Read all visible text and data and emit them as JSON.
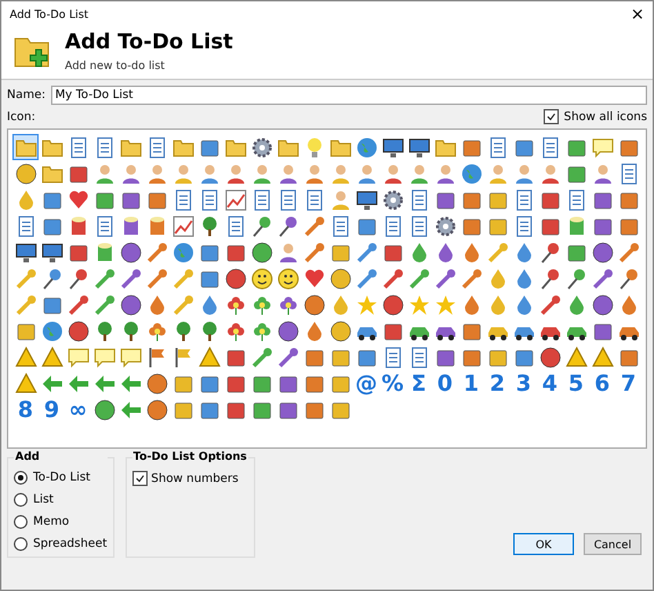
{
  "window": {
    "title": "Add To-Do List",
    "close": "×"
  },
  "header": {
    "title": "Add To-Do List",
    "subtitle": "Add new to-do list"
  },
  "name_field": {
    "label": "Name:",
    "value": "My To-Do List"
  },
  "icon_label": "Icon:",
  "show_all_icons": {
    "label": "Show all icons",
    "checked": true
  },
  "icon_rows": [
    [
      {
        "kind": "folder",
        "selected": true
      },
      {
        "kind": "folder",
        "selected": false
      },
      {
        "kind": "document",
        "selected": false
      },
      {
        "kind": "document",
        "selected": false
      },
      {
        "kind": "folder",
        "selected": false
      },
      {
        "kind": "document",
        "selected": false
      },
      {
        "kind": "folder",
        "selected": false
      },
      {
        "kind": "box",
        "selected": false
      },
      {
        "kind": "folder",
        "selected": false
      },
      {
        "kind": "gear",
        "selected": false
      },
      {
        "kind": "folder",
        "selected": false
      },
      {
        "kind": "bulb",
        "selected": false
      },
      {
        "kind": "folder",
        "selected": false
      },
      {
        "kind": "globe",
        "selected": false
      },
      {
        "kind": "monitor",
        "selected": false
      },
      {
        "kind": "monitor",
        "selected": false
      },
      {
        "kind": "folder",
        "selected": false
      },
      {
        "kind": "box",
        "selected": false
      },
      {
        "kind": "document",
        "selected": false
      },
      {
        "kind": "box",
        "selected": false
      },
      {
        "kind": "document",
        "selected": false
      },
      {
        "kind": "box",
        "selected": false
      },
      {
        "kind": "note",
        "selected": false
      },
      {
        "kind": "box",
        "selected": false
      }
    ],
    [
      {
        "kind": "ball",
        "selected": false
      },
      {
        "kind": "folder",
        "selected": false
      },
      {
        "kind": "box",
        "selected": false
      },
      {
        "kind": "person",
        "selected": false
      },
      {
        "kind": "person",
        "selected": false
      },
      {
        "kind": "person",
        "selected": false
      },
      {
        "kind": "person",
        "selected": false
      },
      {
        "kind": "person",
        "selected": false
      },
      {
        "kind": "person",
        "selected": false
      },
      {
        "kind": "person",
        "selected": false
      },
      {
        "kind": "person",
        "selected": false
      },
      {
        "kind": "person",
        "selected": false
      },
      {
        "kind": "person",
        "selected": false
      },
      {
        "kind": "person",
        "selected": false
      },
      {
        "kind": "person",
        "selected": false
      },
      {
        "kind": "person",
        "selected": false
      },
      {
        "kind": "person",
        "selected": false
      },
      {
        "kind": "globe",
        "selected": false
      },
      {
        "kind": "person",
        "selected": false
      },
      {
        "kind": "person",
        "selected": false
      },
      {
        "kind": "person",
        "selected": false
      },
      {
        "kind": "box",
        "selected": false
      },
      {
        "kind": "person",
        "selected": false
      },
      {
        "kind": "document",
        "selected": false
      }
    ],
    [
      {
        "kind": "drop",
        "selected": false
      },
      {
        "kind": "box",
        "selected": false
      },
      {
        "kind": "heart",
        "selected": false
      },
      {
        "kind": "box",
        "selected": false
      },
      {
        "kind": "box",
        "selected": false
      },
      {
        "kind": "box",
        "selected": false
      },
      {
        "kind": "document",
        "selected": false
      },
      {
        "kind": "document",
        "selected": false
      },
      {
        "kind": "chart",
        "selected": false
      },
      {
        "kind": "document",
        "selected": false
      },
      {
        "kind": "document",
        "selected": false
      },
      {
        "kind": "document",
        "selected": false
      },
      {
        "kind": "person",
        "selected": false
      },
      {
        "kind": "monitor",
        "selected": false
      },
      {
        "kind": "gear",
        "selected": false
      },
      {
        "kind": "document",
        "selected": false
      },
      {
        "kind": "box",
        "selected": false
      },
      {
        "kind": "box",
        "selected": false
      },
      {
        "kind": "box",
        "selected": false
      },
      {
        "kind": "document",
        "selected": false
      },
      {
        "kind": "box",
        "selected": false
      },
      {
        "kind": "document",
        "selected": false
      },
      {
        "kind": "box",
        "selected": false
      },
      {
        "kind": "box",
        "selected": false
      }
    ],
    [
      {
        "kind": "document",
        "selected": false
      },
      {
        "kind": "box",
        "selected": false
      },
      {
        "kind": "cylinder",
        "selected": false
      },
      {
        "kind": "document",
        "selected": false
      },
      {
        "kind": "cylinder",
        "selected": false
      },
      {
        "kind": "cylinder",
        "selected": false
      },
      {
        "kind": "chart",
        "selected": false
      },
      {
        "kind": "tree",
        "selected": false
      },
      {
        "kind": "document",
        "selected": false
      },
      {
        "kind": "pin",
        "selected": false
      },
      {
        "kind": "pin",
        "selected": false
      },
      {
        "kind": "key",
        "selected": false
      },
      {
        "kind": "document",
        "selected": false
      },
      {
        "kind": "box",
        "selected": false
      },
      {
        "kind": "document",
        "selected": false
      },
      {
        "kind": "document",
        "selected": false
      },
      {
        "kind": "gear",
        "selected": false
      },
      {
        "kind": "box",
        "selected": false
      },
      {
        "kind": "box",
        "selected": false
      },
      {
        "kind": "document",
        "selected": false
      },
      {
        "kind": "box",
        "selected": false
      },
      {
        "kind": "cylinder",
        "selected": false
      },
      {
        "kind": "box",
        "selected": false
      },
      {
        "kind": "box",
        "selected": false
      }
    ],
    [
      {
        "kind": "monitor",
        "selected": false
      },
      {
        "kind": "monitor",
        "selected": false
      },
      {
        "kind": "box",
        "selected": false
      },
      {
        "kind": "cylinder",
        "selected": false
      },
      {
        "kind": "ball",
        "selected": false
      },
      {
        "kind": "key",
        "selected": false
      },
      {
        "kind": "globe",
        "selected": false
      },
      {
        "kind": "box",
        "selected": false
      },
      {
        "kind": "box",
        "selected": false
      },
      {
        "kind": "ball",
        "selected": false
      },
      {
        "kind": "person",
        "selected": false
      },
      {
        "kind": "key",
        "selected": false
      },
      {
        "kind": "box",
        "selected": false
      },
      {
        "kind": "key",
        "selected": false
      },
      {
        "kind": "box",
        "selected": false
      },
      {
        "kind": "drop",
        "selected": false
      },
      {
        "kind": "drop",
        "selected": false
      },
      {
        "kind": "drop",
        "selected": false
      },
      {
        "kind": "key",
        "selected": false
      },
      {
        "kind": "drop",
        "selected": false
      },
      {
        "kind": "pin",
        "selected": false
      },
      {
        "kind": "box",
        "selected": false
      },
      {
        "kind": "ball",
        "selected": false
      },
      {
        "kind": "key",
        "selected": false
      }
    ],
    [
      {
        "kind": "key",
        "selected": false
      },
      {
        "kind": "pin",
        "selected": false
      },
      {
        "kind": "pin",
        "selected": false
      },
      {
        "kind": "key",
        "selected": false
      },
      {
        "kind": "key",
        "selected": false
      },
      {
        "kind": "key",
        "selected": false
      },
      {
        "kind": "key",
        "selected": false
      },
      {
        "kind": "box",
        "selected": false
      },
      {
        "kind": "ball",
        "selected": false
      },
      {
        "kind": "face",
        "selected": false
      },
      {
        "kind": "face",
        "selected": false
      },
      {
        "kind": "heart",
        "selected": false
      },
      {
        "kind": "ball",
        "selected": false
      },
      {
        "kind": "key",
        "selected": false
      },
      {
        "kind": "key",
        "selected": false
      },
      {
        "kind": "key",
        "selected": false
      },
      {
        "kind": "key",
        "selected": false
      },
      {
        "kind": "key",
        "selected": false
      },
      {
        "kind": "drop",
        "selected": false
      },
      {
        "kind": "drop",
        "selected": false
      },
      {
        "kind": "pin",
        "selected": false
      },
      {
        "kind": "pin",
        "selected": false
      },
      {
        "kind": "key",
        "selected": false
      },
      {
        "kind": "pin",
        "selected": false
      }
    ],
    [
      {
        "kind": "key",
        "selected": false
      },
      {
        "kind": "box",
        "selected": false
      },
      {
        "kind": "key",
        "selected": false
      },
      {
        "kind": "key",
        "selected": false
      },
      {
        "kind": "ball",
        "selected": false
      },
      {
        "kind": "drop",
        "selected": false
      },
      {
        "kind": "key",
        "selected": false
      },
      {
        "kind": "drop",
        "selected": false
      },
      {
        "kind": "flower",
        "selected": false
      },
      {
        "kind": "flower",
        "selected": false
      },
      {
        "kind": "flower",
        "selected": false
      },
      {
        "kind": "ball",
        "selected": false
      },
      {
        "kind": "drop",
        "selected": false
      },
      {
        "kind": "star",
        "selected": false
      },
      {
        "kind": "ball",
        "selected": false
      },
      {
        "kind": "star",
        "selected": false
      },
      {
        "kind": "star",
        "selected": false
      },
      {
        "kind": "drop",
        "selected": false
      },
      {
        "kind": "drop",
        "selected": false
      },
      {
        "kind": "drop",
        "selected": false
      },
      {
        "kind": "key",
        "selected": false
      },
      {
        "kind": "drop",
        "selected": false
      },
      {
        "kind": "ball",
        "selected": false
      },
      {
        "kind": "drop",
        "selected": false
      }
    ],
    [
      {
        "kind": "box",
        "selected": false
      },
      {
        "kind": "globe",
        "selected": false
      },
      {
        "kind": "ball",
        "selected": false
      },
      {
        "kind": "tree",
        "selected": false
      },
      {
        "kind": "tree",
        "selected": false
      },
      {
        "kind": "flower",
        "selected": false
      },
      {
        "kind": "tree",
        "selected": false
      },
      {
        "kind": "tree",
        "selected": false
      },
      {
        "kind": "flower",
        "selected": false
      },
      {
        "kind": "flower",
        "selected": false
      },
      {
        "kind": "ball",
        "selected": false
      },
      {
        "kind": "drop",
        "selected": false
      },
      {
        "kind": "ball",
        "selected": false
      },
      {
        "kind": "car",
        "selected": false
      },
      {
        "kind": "box",
        "selected": false
      },
      {
        "kind": "car",
        "selected": false
      },
      {
        "kind": "car",
        "selected": false
      },
      {
        "kind": "box",
        "selected": false
      },
      {
        "kind": "car",
        "selected": false
      },
      {
        "kind": "car",
        "selected": false
      },
      {
        "kind": "car",
        "selected": false
      },
      {
        "kind": "car",
        "selected": false
      },
      {
        "kind": "box",
        "selected": false
      },
      {
        "kind": "car",
        "selected": false
      }
    ],
    [
      {
        "kind": "sign",
        "selected": false
      },
      {
        "kind": "sign",
        "selected": false
      },
      {
        "kind": "note",
        "selected": false
      },
      {
        "kind": "note",
        "selected": false
      },
      {
        "kind": "note",
        "selected": false
      },
      {
        "kind": "flag",
        "selected": false
      },
      {
        "kind": "flag",
        "selected": false
      },
      {
        "kind": "sign",
        "selected": false
      },
      {
        "kind": "box",
        "selected": false
      },
      {
        "kind": "key",
        "selected": false
      },
      {
        "kind": "key",
        "selected": false
      },
      {
        "kind": "box",
        "selected": false
      },
      {
        "kind": "box",
        "selected": false
      },
      {
        "kind": "box",
        "selected": false
      },
      {
        "kind": "document",
        "selected": false
      },
      {
        "kind": "document",
        "selected": false
      },
      {
        "kind": "box",
        "selected": false
      },
      {
        "kind": "box",
        "selected": false
      },
      {
        "kind": "box",
        "selected": false
      },
      {
        "kind": "box",
        "selected": false
      },
      {
        "kind": "ball",
        "selected": false
      },
      {
        "kind": "sign",
        "selected": false
      },
      {
        "kind": "sign",
        "selected": false
      },
      {
        "kind": "box",
        "selected": false
      }
    ],
    [
      {
        "kind": "sign",
        "selected": false
      },
      {
        "kind": "arrow",
        "selected": false
      },
      {
        "kind": "arrow",
        "selected": false
      },
      {
        "kind": "arrow",
        "selected": false
      },
      {
        "kind": "arrow",
        "selected": false
      },
      {
        "kind": "ball",
        "selected": false
      },
      {
        "kind": "box",
        "selected": false
      },
      {
        "kind": "box",
        "selected": false
      },
      {
        "kind": "box",
        "selected": false
      },
      {
        "kind": "box",
        "selected": false
      },
      {
        "kind": "box",
        "selected": false
      },
      {
        "kind": "box",
        "selected": false
      },
      {
        "kind": "box",
        "selected": false
      },
      {
        "kind": "glyph",
        "text": "@",
        "selected": false
      },
      {
        "kind": "glyph",
        "text": "%",
        "selected": false
      },
      {
        "kind": "glyph",
        "text": "Σ",
        "selected": false
      },
      {
        "kind": "glyph",
        "text": "0",
        "selected": false
      },
      {
        "kind": "glyph",
        "text": "1",
        "selected": false
      },
      {
        "kind": "glyph",
        "text": "2",
        "selected": false
      },
      {
        "kind": "glyph",
        "text": "3",
        "selected": false
      },
      {
        "kind": "glyph",
        "text": "4",
        "selected": false
      },
      {
        "kind": "glyph",
        "text": "5",
        "selected": false
      },
      {
        "kind": "glyph",
        "text": "6",
        "selected": false
      },
      {
        "kind": "glyph",
        "text": "7",
        "selected": false
      }
    ],
    [
      {
        "kind": "glyph",
        "text": "8",
        "selected": false
      },
      {
        "kind": "glyph",
        "text": "9",
        "selected": false
      },
      {
        "kind": "glyph",
        "text": "∞",
        "selected": false
      },
      {
        "kind": "ball",
        "selected": false
      },
      {
        "kind": "arrow",
        "selected": false
      },
      {
        "kind": "ball",
        "selected": false
      },
      {
        "kind": "box",
        "selected": false
      },
      {
        "kind": "box",
        "selected": false
      },
      {
        "kind": "box",
        "selected": false
      },
      {
        "kind": "box",
        "selected": false
      },
      {
        "kind": "box",
        "selected": false
      },
      {
        "kind": "box",
        "selected": false
      },
      {
        "kind": "box",
        "selected": false
      }
    ]
  ],
  "add_group": {
    "title": "Add",
    "options": [
      {
        "label": "To-Do List",
        "selected": true
      },
      {
        "label": "List",
        "selected": false
      },
      {
        "label": "Memo",
        "selected": false
      },
      {
        "label": "Spreadsheet",
        "selected": false
      }
    ]
  },
  "options_group": {
    "title": "To-Do List Options",
    "show_numbers": {
      "label": "Show numbers",
      "checked": true
    }
  },
  "buttons": [
    {
      "label": "OK",
      "kind": "default"
    },
    {
      "label": "Cancel",
      "kind": "normal"
    }
  ]
}
